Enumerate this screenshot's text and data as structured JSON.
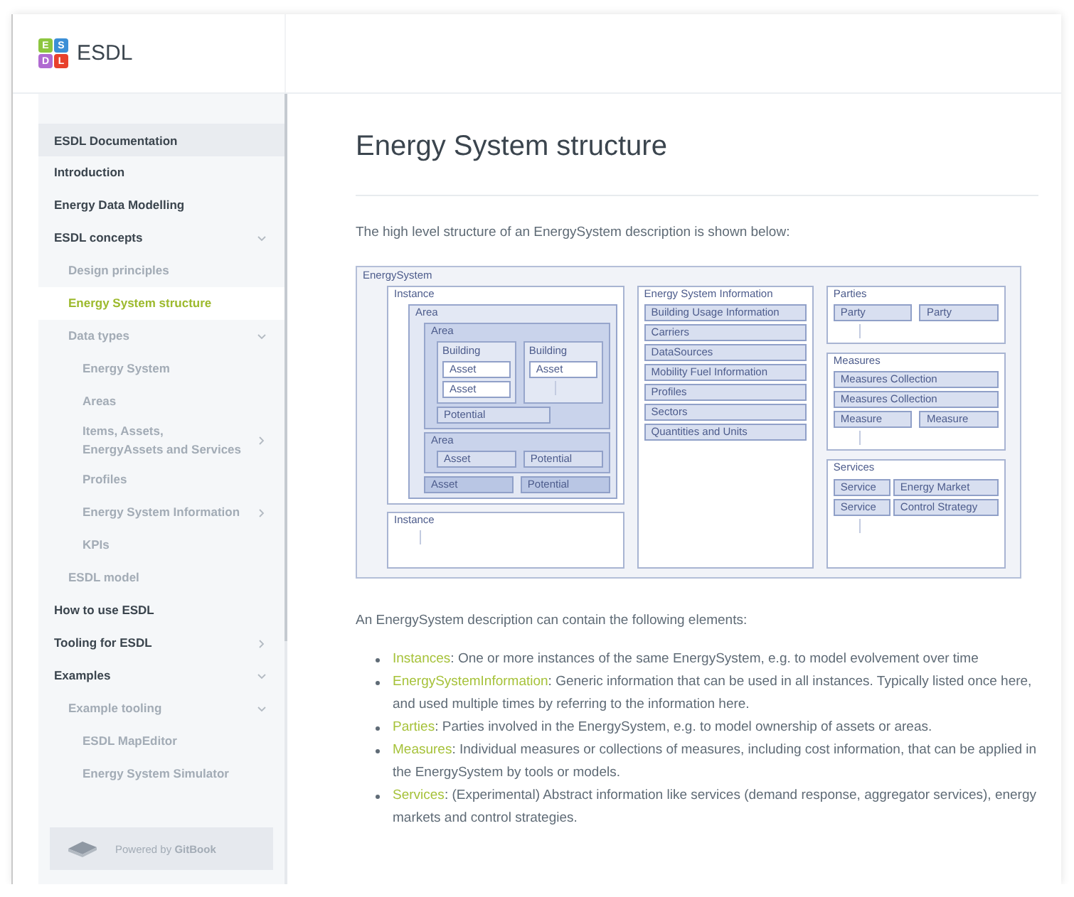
{
  "header": {
    "logo_letters": [
      "E",
      "S",
      "D",
      "L"
    ],
    "site_name": "ESDL"
  },
  "sidebar": {
    "title": "ESDL Documentation",
    "items": [
      {
        "label": "Introduction",
        "selected": false
      },
      {
        "label": "Energy Data Modelling",
        "selected": false
      },
      {
        "label": "ESDL concepts",
        "selected": false,
        "expanded": true,
        "children": [
          {
            "label": "Design principles",
            "selected": false
          },
          {
            "label": "Energy System structure",
            "selected": true
          },
          {
            "label": "Data types",
            "selected": false,
            "expanded": true,
            "children": [
              {
                "label": "Energy System",
                "selected": false
              },
              {
                "label": "Areas",
                "selected": false
              },
              {
                "label": "Items, Assets,\nEnergyAssets and Services",
                "selected": false,
                "expanded": false
              },
              {
                "label": "Profiles",
                "selected": false
              },
              {
                "label": "Energy System Information",
                "selected": false,
                "expanded": false
              },
              {
                "label": "KPIs",
                "selected": false
              }
            ]
          },
          {
            "label": "ESDL model",
            "selected": false
          }
        ]
      },
      {
        "label": "How to use ESDL",
        "selected": false
      },
      {
        "label": "Tooling for ESDL",
        "selected": false,
        "expanded": false
      },
      {
        "label": "Examples",
        "selected": false,
        "expanded": true,
        "children": [
          {
            "label": "Example tooling",
            "selected": false,
            "expanded": true,
            "children": [
              {
                "label": "ESDL MapEditor",
                "selected": false
              },
              {
                "label": "Energy System Simulator",
                "selected": false
              }
            ]
          }
        ]
      }
    ],
    "powered_by": "Powered by **GitBook**"
  },
  "page": {
    "title": "Energy System structure",
    "intro": "The high level structure of an EnergySystem description is shown below:",
    "diagram": {
      "title": "EnergySystem",
      "instance": {
        "title": "Instance",
        "area": {
          "title": "Area",
          "inner_area": {
            "title": "Area",
            "buildings": [
              {
                "title": "Building",
                "assets": [
                  "Asset",
                  "Asset"
                ]
              },
              {
                "title": "Building",
                "assets": [
                  "Asset"
                ]
              }
            ],
            "potential": "Potential"
          },
          "lower_area": {
            "title": "Area",
            "items": [
              "Asset",
              "Potential"
            ]
          },
          "items": [
            "Asset",
            "Potential"
          ]
        }
      },
      "second_instance": {
        "title": "Instance"
      },
      "information": {
        "title": "Energy System Information",
        "items": [
          "Building Usage Information",
          "Carriers",
          "DataSources",
          "Mobility Fuel Information",
          "Profiles",
          "Sectors",
          "Quantities and Units"
        ]
      },
      "parties": {
        "title": "Parties",
        "items": [
          "Party",
          "Party"
        ]
      },
      "measures": {
        "title": "Measures",
        "collections": [
          "Measures Collection",
          "Measures Collection"
        ],
        "items": [
          "Measure",
          "Measure"
        ]
      },
      "services": {
        "title": "Services",
        "items": [
          "Service",
          "Energy Market",
          "Service",
          "Control Strategy"
        ]
      }
    },
    "elements_intro": "An EnergySystem description can contain the following elements:",
    "elements": [
      {
        "term": "Instances",
        "text": ": One or more instances of the same EnergySystem, e.g. to model evolvement over time"
      },
      {
        "term": "EnergySystemInformation",
        "text": ": Generic information that can be used in all instances. Typically listed once here, and used multiple times by referring to the information here."
      },
      {
        "term": "Parties",
        "text": ": Parties involved in the EnergySystem, e.g. to model ownership of assets or areas."
      },
      {
        "term": "Measures",
        "text": ": Individual measures or collections of measures, including cost information, that can be applied in the EnergySystem by tools or models."
      },
      {
        "term": "Services",
        "text": ": (Experimental) Abstract information like services (demand response, aggregator services), energy markets and control strategies."
      }
    ]
  }
}
